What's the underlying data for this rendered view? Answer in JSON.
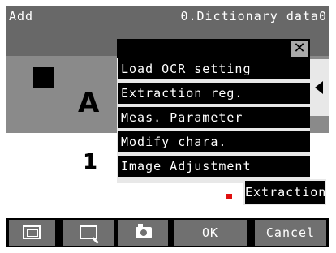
{
  "header": {
    "mode_label": "Add",
    "dictionary_label": "0.Dictionary data0"
  },
  "camera_image": {
    "text_line_1": "A E",
    "text_line_2": "1 2"
  },
  "popup_menu": {
    "close_symbol": "✕",
    "items": [
      {
        "label": "Load OCR setting"
      },
      {
        "label": "Extraction reg."
      },
      {
        "label": "Meas. Parameter"
      },
      {
        "label": "Modify chara."
      },
      {
        "label": "Image Adjustment"
      }
    ]
  },
  "extraction_button": {
    "label": "Extraction"
  },
  "bottom_toolbar": {
    "icons": [
      "frame-icon",
      "zoom-icon",
      "camera-icon"
    ],
    "ok_label": "OK",
    "cancel_label": "Cancel"
  },
  "colors": {
    "title_bar": "#686868",
    "menu_item_bg": "#000000",
    "button_bg": "#707070",
    "marker": "#e01010"
  }
}
